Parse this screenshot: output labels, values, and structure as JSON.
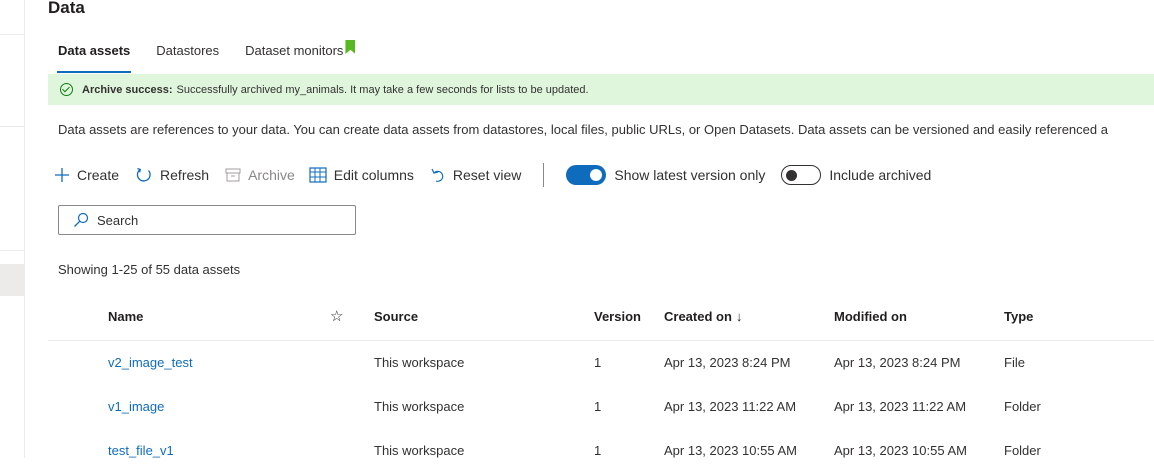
{
  "page": {
    "title": "Data"
  },
  "tabs": [
    {
      "label": "Data assets",
      "active": true
    },
    {
      "label": "Datastores",
      "active": false
    },
    {
      "label": "Dataset monitors",
      "active": false
    }
  ],
  "banner": {
    "bold": "Archive success:",
    "message": "Successfully archived my_animals. It may take a few seconds for lists to be updated.",
    "color": "#dff6dd"
  },
  "description": "Data assets are references to your data. You can create data assets from datastores, local files, public URLs, or Open Datasets. Data assets can be versioned and easily referenced a",
  "toolbar": {
    "create": "Create",
    "refresh": "Refresh",
    "archive": "Archive",
    "edit_columns": "Edit columns",
    "reset_view": "Reset view",
    "show_latest": "Show latest version only",
    "include_archived": "Include archived"
  },
  "search": {
    "placeholder": "Search"
  },
  "count_text": "Showing 1-25 of 55 data assets",
  "columns": {
    "name": "Name",
    "source": "Source",
    "version": "Version",
    "created": "Created on",
    "modified": "Modified on",
    "type": "Type"
  },
  "rows": [
    {
      "name": "v2_image_test",
      "source": "This workspace",
      "version": "1",
      "created": "Apr 13, 2023 8:24 PM",
      "modified": "Apr 13, 2023 8:24 PM",
      "type": "File"
    },
    {
      "name": "v1_image",
      "source": "This workspace",
      "version": "1",
      "created": "Apr 13, 2023 11:22 AM",
      "modified": "Apr 13, 2023 11:22 AM",
      "type": "Folder"
    },
    {
      "name": "test_file_v1",
      "source": "This workspace",
      "version": "1",
      "created": "Apr 13, 2023 10:55 AM",
      "modified": "Apr 13, 2023 10:55 AM",
      "type": "Folder"
    }
  ],
  "colors": {
    "accent": "#0f6cbd",
    "success": "#107c10",
    "bookmark": "#57b821"
  }
}
